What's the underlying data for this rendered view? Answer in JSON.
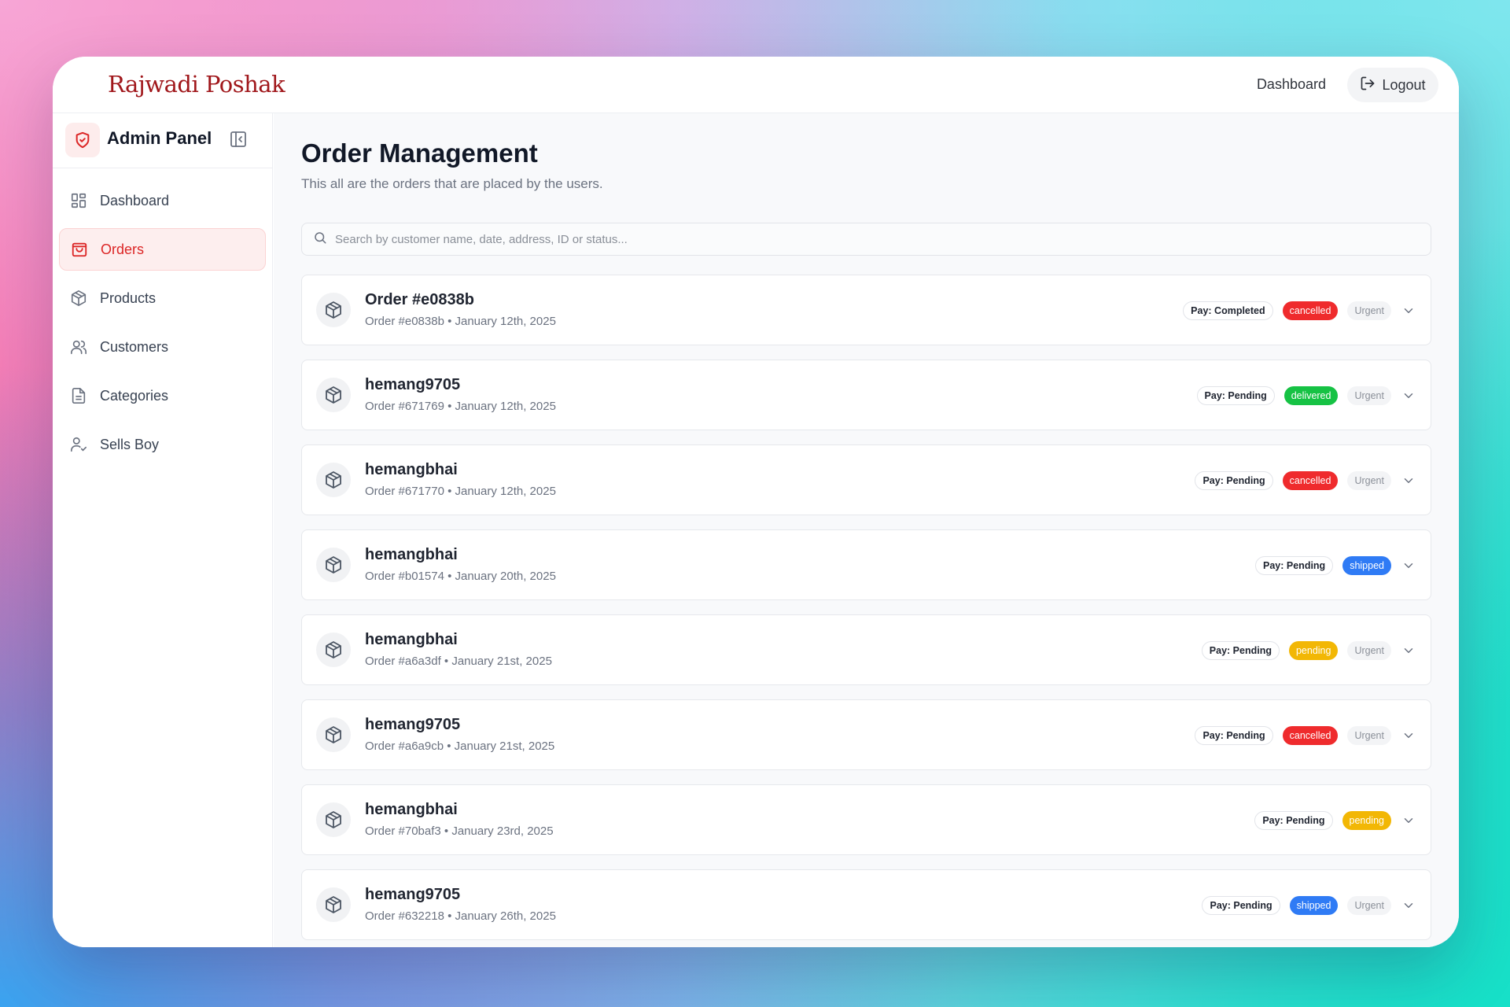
{
  "brand": "Rajwadi Poshak",
  "topbar": {
    "dashboard_link": "Dashboard",
    "logout_label": "Logout"
  },
  "sidebar": {
    "title": "Admin Panel",
    "items": [
      {
        "label": "Dashboard",
        "icon": "dashboard-icon",
        "active": false
      },
      {
        "label": "Orders",
        "icon": "shopping-bag-icon",
        "active": true
      },
      {
        "label": "Products",
        "icon": "package-icon",
        "active": false
      },
      {
        "label": "Customers",
        "icon": "users-icon",
        "active": false
      },
      {
        "label": "Categories",
        "icon": "file-text-icon",
        "active": false
      },
      {
        "label": "Sells Boy",
        "icon": "user-check-icon",
        "active": false
      }
    ]
  },
  "page": {
    "title": "Order Management",
    "subtitle": "This all are the orders that are placed by the users.",
    "search_placeholder": "Search by customer name, date, address, ID or status..."
  },
  "status_colors": {
    "cancelled": "#ef2b2d",
    "delivered": "#16c244",
    "shipped": "#2f7bf5",
    "pending": "#f2b705"
  },
  "orders": [
    {
      "name": "Order #e0838b",
      "meta": "Order #e0838b • January 12th, 2025",
      "pay": "Pay: Completed",
      "status": "cancelled",
      "urgent": "Urgent"
    },
    {
      "name": "hemang9705",
      "meta": "Order #671769 • January 12th, 2025",
      "pay": "Pay: Pending",
      "status": "delivered",
      "urgent": "Urgent"
    },
    {
      "name": "hemangbhai",
      "meta": "Order #671770 • January 12th, 2025",
      "pay": "Pay: Pending",
      "status": "cancelled",
      "urgent": "Urgent"
    },
    {
      "name": "hemangbhai",
      "meta": "Order #b01574 • January 20th, 2025",
      "pay": "Pay: Pending",
      "status": "shipped",
      "urgent": ""
    },
    {
      "name": "hemangbhai",
      "meta": "Order #a6a3df • January 21st, 2025",
      "pay": "Pay: Pending",
      "status": "pending",
      "urgent": "Urgent"
    },
    {
      "name": "hemang9705",
      "meta": "Order #a6a9cb • January 21st, 2025",
      "pay": "Pay: Pending",
      "status": "cancelled",
      "urgent": "Urgent"
    },
    {
      "name": "hemangbhai",
      "meta": "Order #70baf3 • January 23rd, 2025",
      "pay": "Pay: Pending",
      "status": "pending",
      "urgent": ""
    },
    {
      "name": "hemang9705",
      "meta": "Order #632218 • January 26th, 2025",
      "pay": "Pay: Pending",
      "status": "shipped",
      "urgent": "Urgent"
    }
  ]
}
